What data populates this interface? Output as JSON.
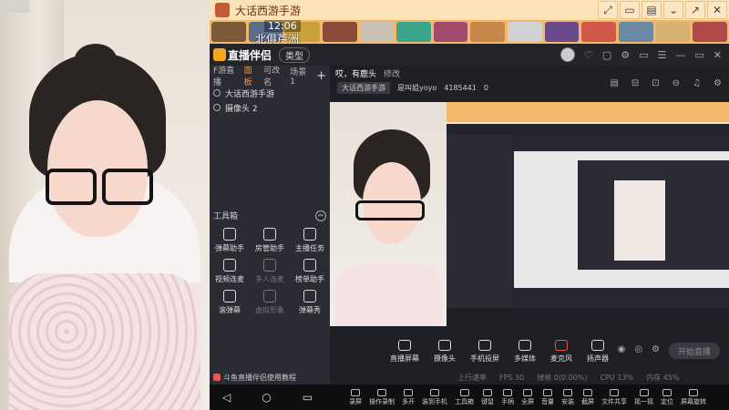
{
  "game_window": {
    "title": "大话西游手游",
    "time": "12:06",
    "location": "北俱芦洲",
    "window_buttons": [
      "⤢",
      "▭",
      "▤",
      "⌄",
      "↗",
      "✕"
    ]
  },
  "app": {
    "brand": "直播伴侣",
    "mode_tag": "类型",
    "header_icons": [
      "♡",
      "▢",
      "⚙",
      "▭",
      "☰",
      "—",
      "▭",
      "✕"
    ]
  },
  "left_panel": {
    "scene_tabs": [
      "F游直播",
      "面板",
      "可改名",
      "场景 1"
    ],
    "active_tab_index": 1,
    "add_label": "+",
    "sources": [
      {
        "label": "大话西游手游"
      },
      {
        "label": "摄像头 2"
      }
    ],
    "tools_title": "工具箱",
    "tools": [
      {
        "label": "弹幕助手",
        "enabled": true
      },
      {
        "label": "房管助手",
        "enabled": true
      },
      {
        "label": "主播任务",
        "enabled": true
      },
      {
        "label": "视频连麦",
        "enabled": true
      },
      {
        "label": "多人连麦",
        "enabled": false
      },
      {
        "label": "榜单助手",
        "enabled": true
      },
      {
        "label": "滚弹幕",
        "enabled": true
      },
      {
        "label": "虚拟形象",
        "enabled": false
      },
      {
        "label": "弹幕秀",
        "enabled": true
      }
    ],
    "notice": "斗鱼直播伴侣使用教程"
  },
  "room": {
    "title": "哎，有鹿头",
    "edit_label": "修改",
    "category": "大话西游手游",
    "streamer": "是叫姐yoyo",
    "room_id": "4185441",
    "heat": "0",
    "right_icons": [
      "▤",
      "⊟",
      "⊡",
      "⊖",
      "♫",
      "⚙"
    ]
  },
  "controls": [
    {
      "label": "直播屏幕",
      "name": "screen-capture"
    },
    {
      "label": "摄像头",
      "name": "camera"
    },
    {
      "label": "手机投屏",
      "name": "phone-cast"
    },
    {
      "label": "多媒体",
      "name": "media"
    },
    {
      "label": "麦克风",
      "name": "microphone"
    },
    {
      "label": "扬声器",
      "name": "speaker"
    }
  ],
  "live_button": "开始直播",
  "status": {
    "rate": "上行速率",
    "fps": "FPS 30",
    "drop": "掉帧 0(0.00%)",
    "cpu": "CPU 13%",
    "memory": "内存 45%"
  },
  "taskbar": {
    "nav": [
      "◁",
      "○",
      "▭"
    ],
    "items": [
      "录屏",
      "操作录制",
      "多开",
      "装到手机",
      "工具箱",
      "键鼠",
      "手柄",
      "全屏",
      "音量",
      "安装",
      "截屏",
      "文件共享",
      "摇一摇",
      "定位",
      "屏幕旋转"
    ]
  }
}
